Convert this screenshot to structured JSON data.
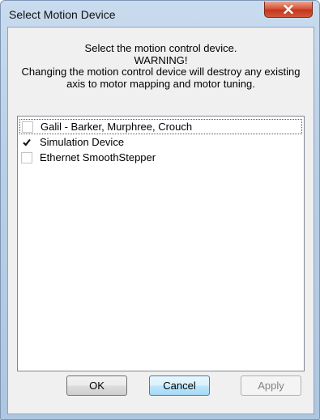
{
  "window": {
    "title": "Select Motion Device"
  },
  "message": {
    "line1": "Select the motion control device.",
    "line2": "WARNING!",
    "line3": "Changing the motion control device will destroy any existing",
    "line4": "axis to motor mapping and motor tuning."
  },
  "devices": [
    {
      "label": "Galil - Barker, Murphree, Crouch",
      "checked": false,
      "focused": true
    },
    {
      "label": "Simulation Device",
      "checked": true,
      "focused": false
    },
    {
      "label": "Ethernet SmoothStepper",
      "checked": false,
      "focused": false
    }
  ],
  "buttons": {
    "ok": "OK",
    "cancel": "Cancel",
    "apply": "Apply"
  },
  "colors": {
    "close_button": "#c3371c",
    "hot_button": "#3c7fb1"
  },
  "icons": {
    "close": "close-x-icon",
    "check": "checkmark-icon"
  }
}
